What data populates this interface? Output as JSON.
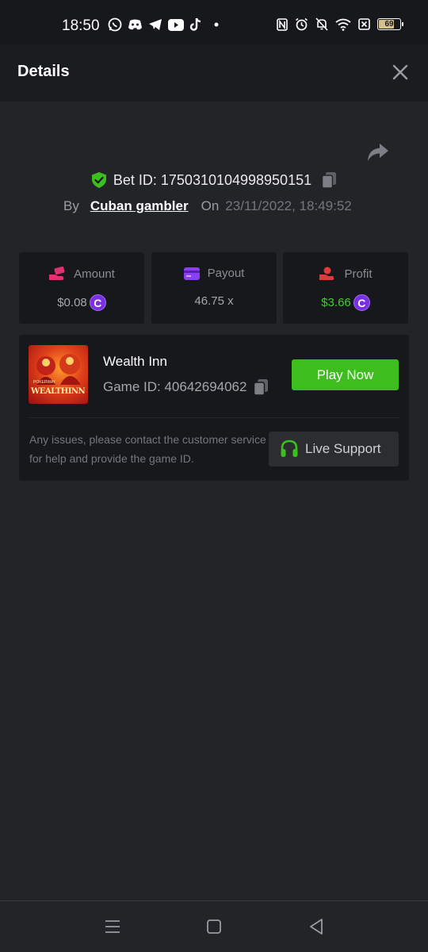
{
  "status_bar": {
    "time": "18:50",
    "battery": "69",
    "app_icons": [
      "whatsapp-icon",
      "discord-icon",
      "telegram-icon",
      "youtube-icon",
      "tiktok-icon"
    ],
    "system_icons": [
      "nfc-icon",
      "alarm-icon",
      "mute-icon",
      "wifi-icon",
      "sim-off-icon",
      "battery-icon"
    ]
  },
  "header": {
    "title": "Details"
  },
  "bet": {
    "bet_id_label": "Bet ID: 1750310104998950151",
    "by_label": "By",
    "user_name": "Cuban gambler",
    "on_label": "On",
    "date": "23/11/2022, 18:49:52"
  },
  "stats": {
    "amount": {
      "label": "Amount",
      "value": "$0.08",
      "icon": "money-hand-icon"
    },
    "payout": {
      "label": "Payout",
      "value": "46.75 x",
      "icon": "card-icon"
    },
    "profit": {
      "label": "Profit",
      "value": "$3.66",
      "icon": "profit-hand-icon"
    },
    "coin_symbol": "C"
  },
  "game": {
    "name": "Wealth Inn",
    "game_id_label": "Game ID: 40642694062",
    "thumbnail_text": "WEALTHINN",
    "thumbnail_small": "POKERWAY",
    "play_label": "Play Now",
    "issue_text": "Any issues, please contact the customer service for help and provide the game ID.",
    "support_label": "Live Support"
  },
  "colors": {
    "accent_green": "#3dbe1e",
    "profit_green": "#3fce2a",
    "coin_purple": "#7b2fe0",
    "background": "#232428",
    "card": "#17181b"
  }
}
